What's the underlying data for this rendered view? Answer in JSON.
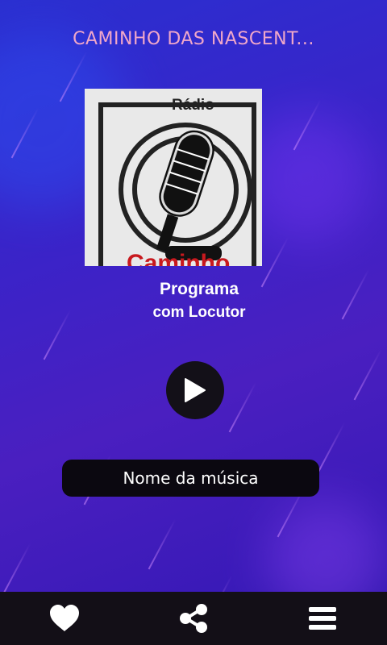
{
  "header": {
    "title": "CAMINHO DAS NASCENT..."
  },
  "cover": {
    "top_text": "Rádio",
    "bottom_text": "Caminho"
  },
  "program": {
    "title": "Programa",
    "subtitle": "com Locutor"
  },
  "player": {
    "song_name": "Nome da música"
  },
  "bottom_nav": {
    "items": [
      "heart-icon",
      "share-icon",
      "menu-icon"
    ]
  },
  "colors": {
    "title": "#f0a7c9",
    "bar": "#130f17",
    "accent": "#3b23c8"
  }
}
